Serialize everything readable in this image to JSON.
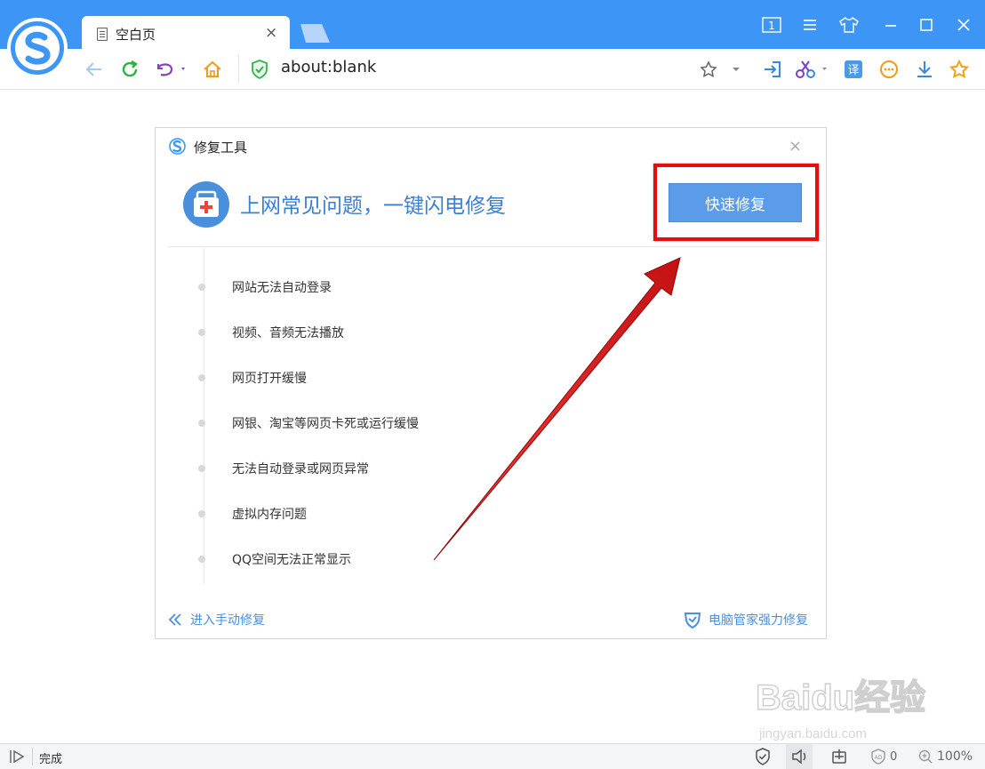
{
  "browser": {
    "tab_title": "空白页",
    "tab_close": "×",
    "address": "about:blank",
    "window_buttons": [
      "1",
      "menu",
      "skin",
      "minimize",
      "maximize",
      "close"
    ]
  },
  "toolbar": {
    "icons": [
      "back-icon",
      "refresh-icon",
      "undo-icon",
      "home-icon",
      "shield-icon",
      "star-icon",
      "login-icon",
      "scissors-icon",
      "translate-icon",
      "more-icon",
      "download-icon",
      "favorites-icon"
    ],
    "translate_glyph": "译"
  },
  "dialog": {
    "title": "修复工具",
    "close": "×",
    "headline": "上网常见问题，一键闪电修复",
    "fix_button": "快速修复",
    "issues": [
      "网站无法自动登录",
      "视频、音频无法播放",
      "网页打开缓慢",
      "网银、淘宝等网页卡死或运行缓慢",
      "无法自动登录或网页异常",
      "虚拟内存问题",
      "QQ空间无法正常显示"
    ],
    "manual_link": "进入手动修复",
    "guard_link": "电脑管家强力修复"
  },
  "status": {
    "text": "完成",
    "ad_count": "0",
    "zoom": "100%"
  },
  "watermark": {
    "brand": "Baidu经验",
    "url": "jingyan.baidu.com"
  },
  "colors": {
    "titlebar": "#3d96f5",
    "accent": "#4a8fdc",
    "button": "#5a9ce8",
    "highlight": "#e80c0c"
  }
}
